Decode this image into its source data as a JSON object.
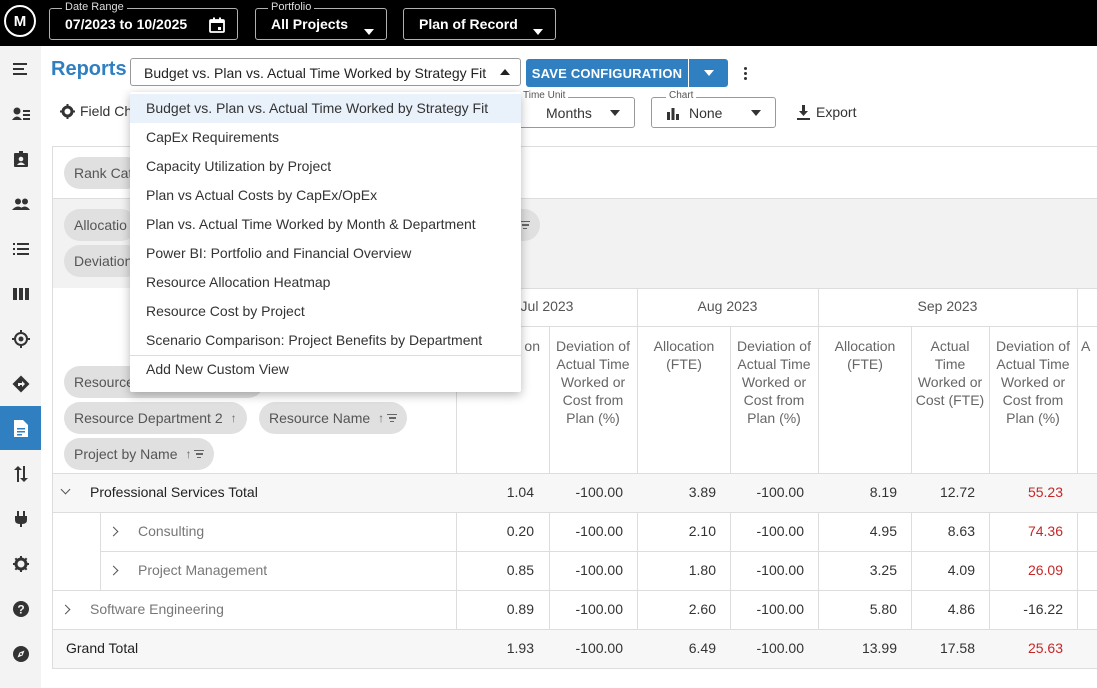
{
  "top_bar": {
    "logo_text": "M",
    "date_range": {
      "label": "Date Range",
      "value": "07/2023 to 10/2025"
    },
    "portfolio": {
      "label": "Portfolio",
      "value": "All Projects"
    },
    "plan": {
      "value": "Plan of Record"
    }
  },
  "sidebar": {
    "items": [
      {
        "icon": "menu-icon"
      },
      {
        "icon": "user-list-icon"
      },
      {
        "icon": "badge-icon"
      },
      {
        "icon": "people-icon"
      },
      {
        "icon": "list-icon"
      },
      {
        "icon": "columns-icon"
      },
      {
        "icon": "target-icon"
      },
      {
        "icon": "directions-icon"
      },
      {
        "icon": "report-icon",
        "active": true
      },
      {
        "icon": "swap-icon"
      },
      {
        "icon": "plug-icon"
      },
      {
        "icon": "gear-icon"
      },
      {
        "icon": "help-icon"
      },
      {
        "icon": "compass-icon"
      }
    ],
    "active_color": "#2f7fc1"
  },
  "header": {
    "title": "Reports",
    "report_select": "Budget vs. Plan vs. Actual Time Worked by Strategy Fit",
    "save_button": "SAVE CONFIGURATION"
  },
  "toolbar": {
    "field_chooser": "Field Ch",
    "time_unit": {
      "label": "Time Unit",
      "value": "Months"
    },
    "chart": {
      "label": "Chart",
      "value": "None"
    },
    "export": "Export"
  },
  "dropdown": {
    "items": [
      "Budget vs. Plan vs. Actual Time Worked by Strategy Fit",
      "CapEx Requirements",
      "Capacity Utilization by Project",
      "Plan vs Actual Costs by CapEx/OpEx",
      "Plan vs. Actual Time Worked by Month & Department",
      "Power BI: Portfolio and Financial Overview",
      "Resource Allocation Heatmap",
      "Resource Cost by Project",
      "Scenario Comparison: Project Benefits by Department"
    ],
    "add_new": "Add New Custom View"
  },
  "pivot": {
    "filter_chip": "Rank Cat",
    "value_chips": [
      "Allocatio",
      "Deviation"
    ],
    "row_chips": {
      "resource": "Resource",
      "resource_department": "Resource Department 2",
      "resource_name": "Resource Name",
      "project_by_name": "Project by Name"
    },
    "sort_arrow": "↑"
  },
  "table": {
    "months": [
      "Jul 2023",
      "Aug 2023",
      "Sep 2023"
    ],
    "col_headers": {
      "partial_allocation": "on",
      "deviation": "Deviation of Actual Time Worked or Cost from Plan (%)",
      "allocation": "Allocation (FTE)",
      "actual": "Actual Time Worked or Cost (FTE)",
      "partial_next": "A"
    },
    "rows": [
      {
        "label": "Professional Services Total",
        "level": 0,
        "expanded": true,
        "values": [
          "1.04",
          "-100.00",
          "3.89",
          "-100.00",
          "8.19",
          "12.72",
          "55.23"
        ],
        "neg_last": true
      },
      {
        "label": "Consulting",
        "level": 1,
        "expanded": false,
        "values": [
          "0.20",
          "-100.00",
          "2.10",
          "-100.00",
          "4.95",
          "8.63",
          "74.36"
        ],
        "neg_last": true
      },
      {
        "label": "Project Management",
        "level": 1,
        "expanded": false,
        "values": [
          "0.85",
          "-100.00",
          "1.80",
          "-100.00",
          "3.25",
          "4.09",
          "26.09"
        ],
        "neg_last": true
      },
      {
        "label": "Software Engineering",
        "level": 0,
        "expanded": false,
        "values": [
          "0.89",
          "-100.00",
          "2.60",
          "-100.00",
          "5.80",
          "4.86",
          "-16.22"
        ],
        "neg_last": false
      },
      {
        "label": "Grand Total",
        "level": -1,
        "expanded": false,
        "values": [
          "1.93",
          "-100.00",
          "6.49",
          "-100.00",
          "13.99",
          "17.58",
          "25.63"
        ],
        "neg_last": true
      }
    ]
  },
  "colors": {
    "accent": "#2f7fc1",
    "negative_text": "#c62828"
  }
}
